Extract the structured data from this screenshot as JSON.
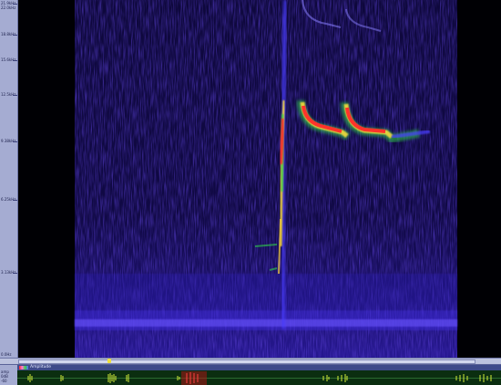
{
  "ruler": {
    "labels": [
      "0.0Hz",
      "3.13kHz",
      "6.25kHz",
      "9.38kHz",
      "12.5kHz",
      "15.6kHz",
      "18.8kHz",
      "21.9kHz",
      "22.0kHz"
    ]
  },
  "amplitude": {
    "title": "Amplitude",
    "side_labels": [
      "amp",
      "0dB",
      "-60"
    ]
  },
  "colors": {
    "background": "#000004",
    "low": "#3a2bd8",
    "mid": "#2fd24a",
    "high": "#ff2a2a",
    "cursor": "#f0e13a"
  }
}
